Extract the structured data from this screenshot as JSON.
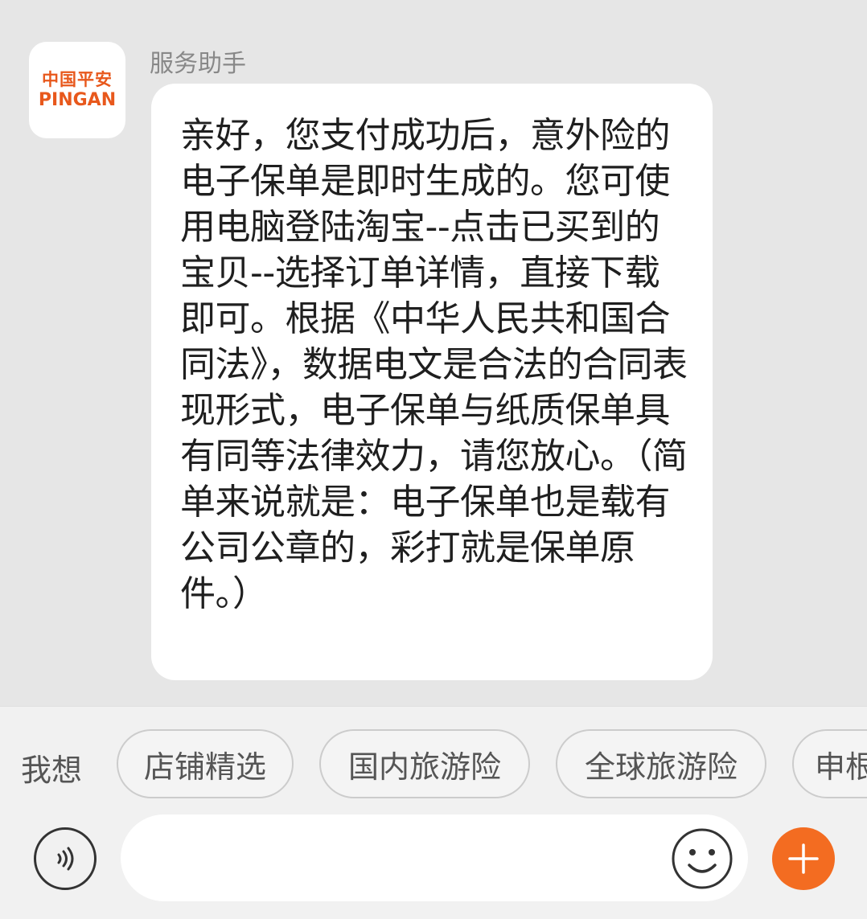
{
  "message": {
    "sender": "服务助手",
    "avatar_logo_cn": "中国平安",
    "avatar_logo_en": "PINGAN",
    "text": "亲好，您支付成功后，意外险的电子保单是即时生成的。您可使用电脑登陆淘宝--点击已买到的宝贝--选择订单详情，直接下载即可。根据《中华人民共和国合同法》，数据电文是合法的合同表现形式，电子保单与纸质保单具有同等法律效力，请您放心。（简单来说就是：电子保单也是载有公司公章的，彩打就是保单原件。）"
  },
  "quick_replies": {
    "label": "我想",
    "chips": [
      "店铺精选",
      "国内旅游险",
      "全球旅游险",
      "申根"
    ]
  },
  "input": {
    "placeholder": "",
    "voice_icon": "voice-icon",
    "emoji_icon": "emoji-icon",
    "plus_icon": "plus-icon"
  },
  "colors": {
    "brand": "#e8581c",
    "plus_button": "#f36c21"
  }
}
